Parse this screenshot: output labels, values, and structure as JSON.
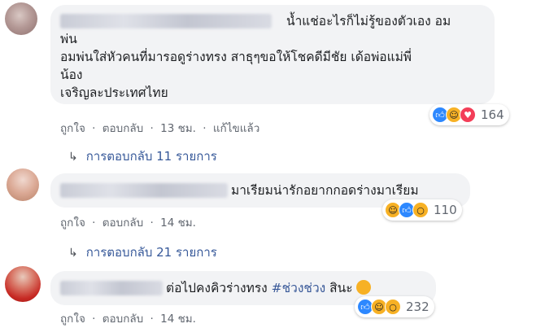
{
  "comments": [
    {
      "lines": [
        "น้ำแช่อะไรก็ไม่รู้ของตัวเอง อม",
        "พ่น",
        "อมพ่นใส่หัวคนที่มารอดูร่างทรง สาธุๆขอให้โชคดีมีชัย เด้อพ่อแม่พี่",
        "น้อง",
        "เจริญละประเทศไทย"
      ],
      "like": "ถูกใจ",
      "reply": "ตอบกลับ",
      "time": "13 ชม.",
      "edited": "แก้ไขแล้ว",
      "reaction_count": "164",
      "reactions": [
        "like-icon",
        "haha-icon",
        "love-icon"
      ],
      "replies": "การตอบกลับ 11 รายการ"
    },
    {
      "text": "มาเรียมน่ารักอยากกอดร่างมาเรียม",
      "like": "ถูกใจ",
      "reply": "ตอบกลับ",
      "time": "14 ชม.",
      "reaction_count": "110",
      "reactions": [
        "haha-icon",
        "like-icon",
        "wow-icon"
      ],
      "replies": "การตอบกลับ 21 รายการ"
    },
    {
      "text": "ต่อไปคงคิวร่างทรง ",
      "hashtag": "#ช่วงช่วง",
      "text_end": " สินะ",
      "like": "ถูกใจ",
      "reply": "ตอบกลับ",
      "time": "14 ชม.",
      "reaction_count": "232",
      "reactions": [
        "like-icon",
        "haha-icon",
        "wow-icon"
      ]
    }
  ],
  "colors": {
    "bubble": "#f2f3f5",
    "link": "#365899",
    "meta": "#616770",
    "like": "#2d88ff",
    "love": "#f33e58",
    "emoji": "#f7b125"
  }
}
